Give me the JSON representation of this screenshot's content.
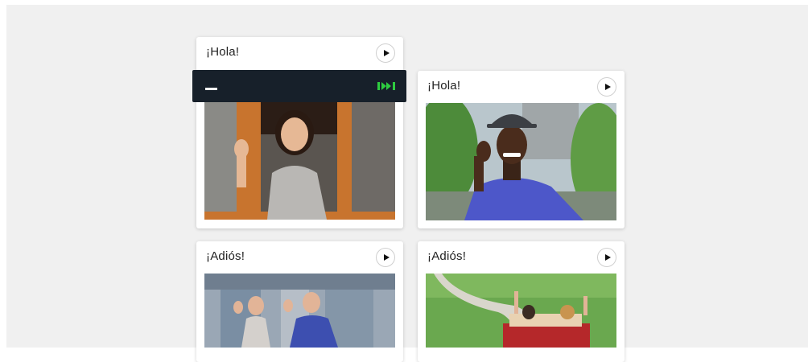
{
  "cards": [
    {
      "title": "¡Hola!",
      "photo": "woman-waving-from-window"
    },
    {
      "title": "¡Hola!",
      "photo": "man-in-hat-waving"
    },
    {
      "title": "¡Adiós!",
      "photo": "couple-waving-at-door"
    },
    {
      "title": "¡Adiós!",
      "photo": "people-waving-from-car"
    }
  ],
  "audio_player": {
    "accent": "#2ecc40",
    "background": "#17202a"
  },
  "icons": {
    "play": "play-icon",
    "audio": "audio-playing-icon"
  }
}
